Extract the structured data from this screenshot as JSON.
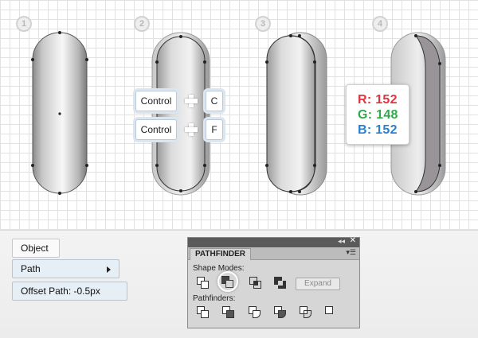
{
  "steps": [
    "1",
    "2",
    "3",
    "4"
  ],
  "shortcuts": {
    "row1_modifier": "Control",
    "row1_key": "C",
    "row2_modifier": "Control",
    "row2_key": "F"
  },
  "color_readout": {
    "r_label": "R: 152",
    "g_label": "G: 148",
    "b_label": "B: 152",
    "r_color": "#e2333f",
    "g_color": "#2eaa4a",
    "b_color": "#2a7fd0",
    "fill_hex": "#989498"
  },
  "menu": {
    "object_label": "Object",
    "path_label": "Path",
    "offset_label": "Offset Path: -0.5px"
  },
  "pathfinder_panel": {
    "collapse_glyph": "◂◂",
    "close_glyph": "✕",
    "tab_label": "PATHFINDER",
    "menu_glyph": "▾☰",
    "shape_modes_label": "Shape Modes:",
    "expand_label": "Expand",
    "pathfinders_label": "Pathfinders:",
    "shape_mode_icons": [
      "unite-icon",
      "minus-front-icon",
      "intersect-icon",
      "exclude-icon"
    ],
    "pathfinder_icons": [
      "divide-icon",
      "trim-icon",
      "merge-icon",
      "crop-icon",
      "outline-icon",
      "minus-back-icon"
    ]
  },
  "colors": {
    "key_border": "#b9c8d8",
    "menu_bg": "#e6eef6",
    "panel_bg": "#d6d6d6"
  }
}
